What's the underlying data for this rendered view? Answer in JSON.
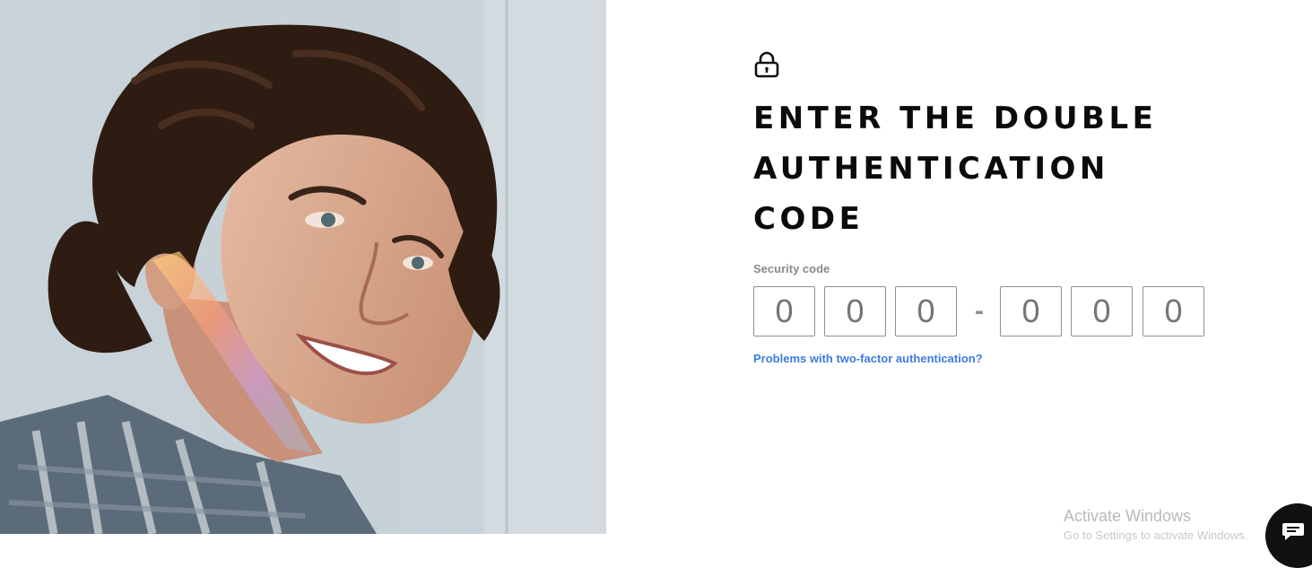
{
  "hero": {
    "alt": "Smiling young man with curly dark hair",
    "icon": "portrait-photo"
  },
  "auth": {
    "lock_icon": "lock-icon",
    "title": "ENTER THE DOUBLE AUTHENTICATION CODE",
    "code_label": "Security code",
    "digits": [
      {
        "placeholder": "0",
        "value": ""
      },
      {
        "placeholder": "0",
        "value": ""
      },
      {
        "placeholder": "0",
        "value": ""
      },
      {
        "placeholder": "0",
        "value": ""
      },
      {
        "placeholder": "0",
        "value": ""
      },
      {
        "placeholder": "0",
        "value": ""
      }
    ],
    "separator": "-",
    "help_link": "Problems with two-factor authentication?"
  },
  "watermark": {
    "title": "Activate Windows",
    "subtitle": "Go to Settings to activate Windows."
  },
  "chat": {
    "icon": "chat-icon"
  },
  "colors": {
    "link": "#3d7be0",
    "title": "#0b0b0b",
    "label": "#8a8a8a",
    "border": "#8f8f8f"
  }
}
